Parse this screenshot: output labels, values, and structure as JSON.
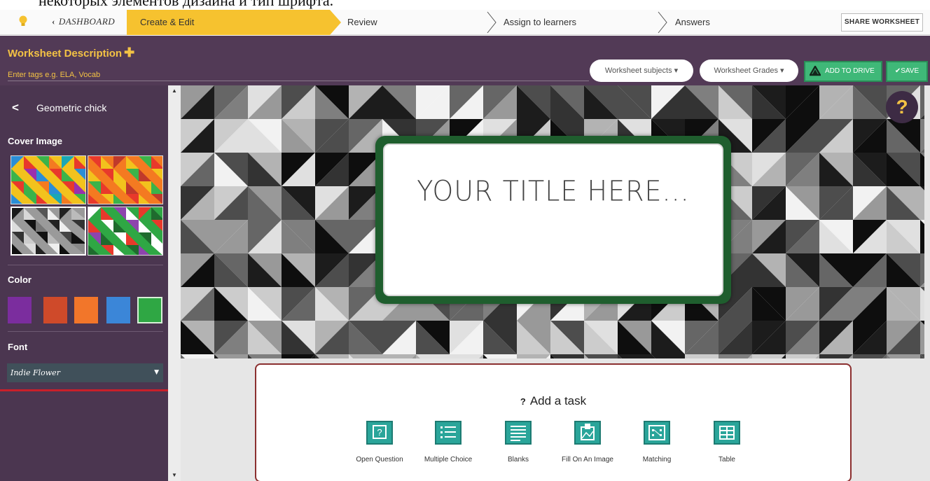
{
  "caption": "некоторых элементов дизайна и тип шрифта.",
  "nav": {
    "dashboard_label": "DASHBOARD",
    "steps": [
      "Create & Edit",
      "Review",
      "Assign to learners",
      "Answers"
    ],
    "share_label": "SHARE WORKSHEET"
  },
  "header": {
    "description_label": "Worksheet Description",
    "tags_placeholder": "Enter tags e.g. ELA, Vocab",
    "subjects_label": "Worksheet subjects ▾",
    "grades_label": "Worksheet Grades ▾",
    "add_to_drive_label": "ADD TO DRIVE",
    "save_label": "✔SAVE"
  },
  "sidebar": {
    "theme_title": "Geometric chick",
    "cover_image_heading": "Cover Image",
    "color_heading": "Color",
    "font_heading": "Font",
    "font_value": "Indie Flower",
    "colors": [
      "#7b2d9e",
      "#cf4a2a",
      "#f2762a",
      "#3b86d8",
      "#2fa744"
    ]
  },
  "cover": {
    "title": "YOUR TITLE HERE...",
    "help_label": "?"
  },
  "tasks": {
    "heading": "Add a task",
    "items": [
      {
        "label": "Open Question",
        "icon": "open-question-icon"
      },
      {
        "label": "Multiple Choice",
        "icon": "multiple-choice-icon"
      },
      {
        "label": "Blanks",
        "icon": "blanks-icon"
      },
      {
        "label": "Fill On An Image",
        "icon": "fill-on-image-icon"
      },
      {
        "label": "Matching",
        "icon": "matching-icon"
      },
      {
        "label": "Table",
        "icon": "table-icon"
      }
    ]
  }
}
